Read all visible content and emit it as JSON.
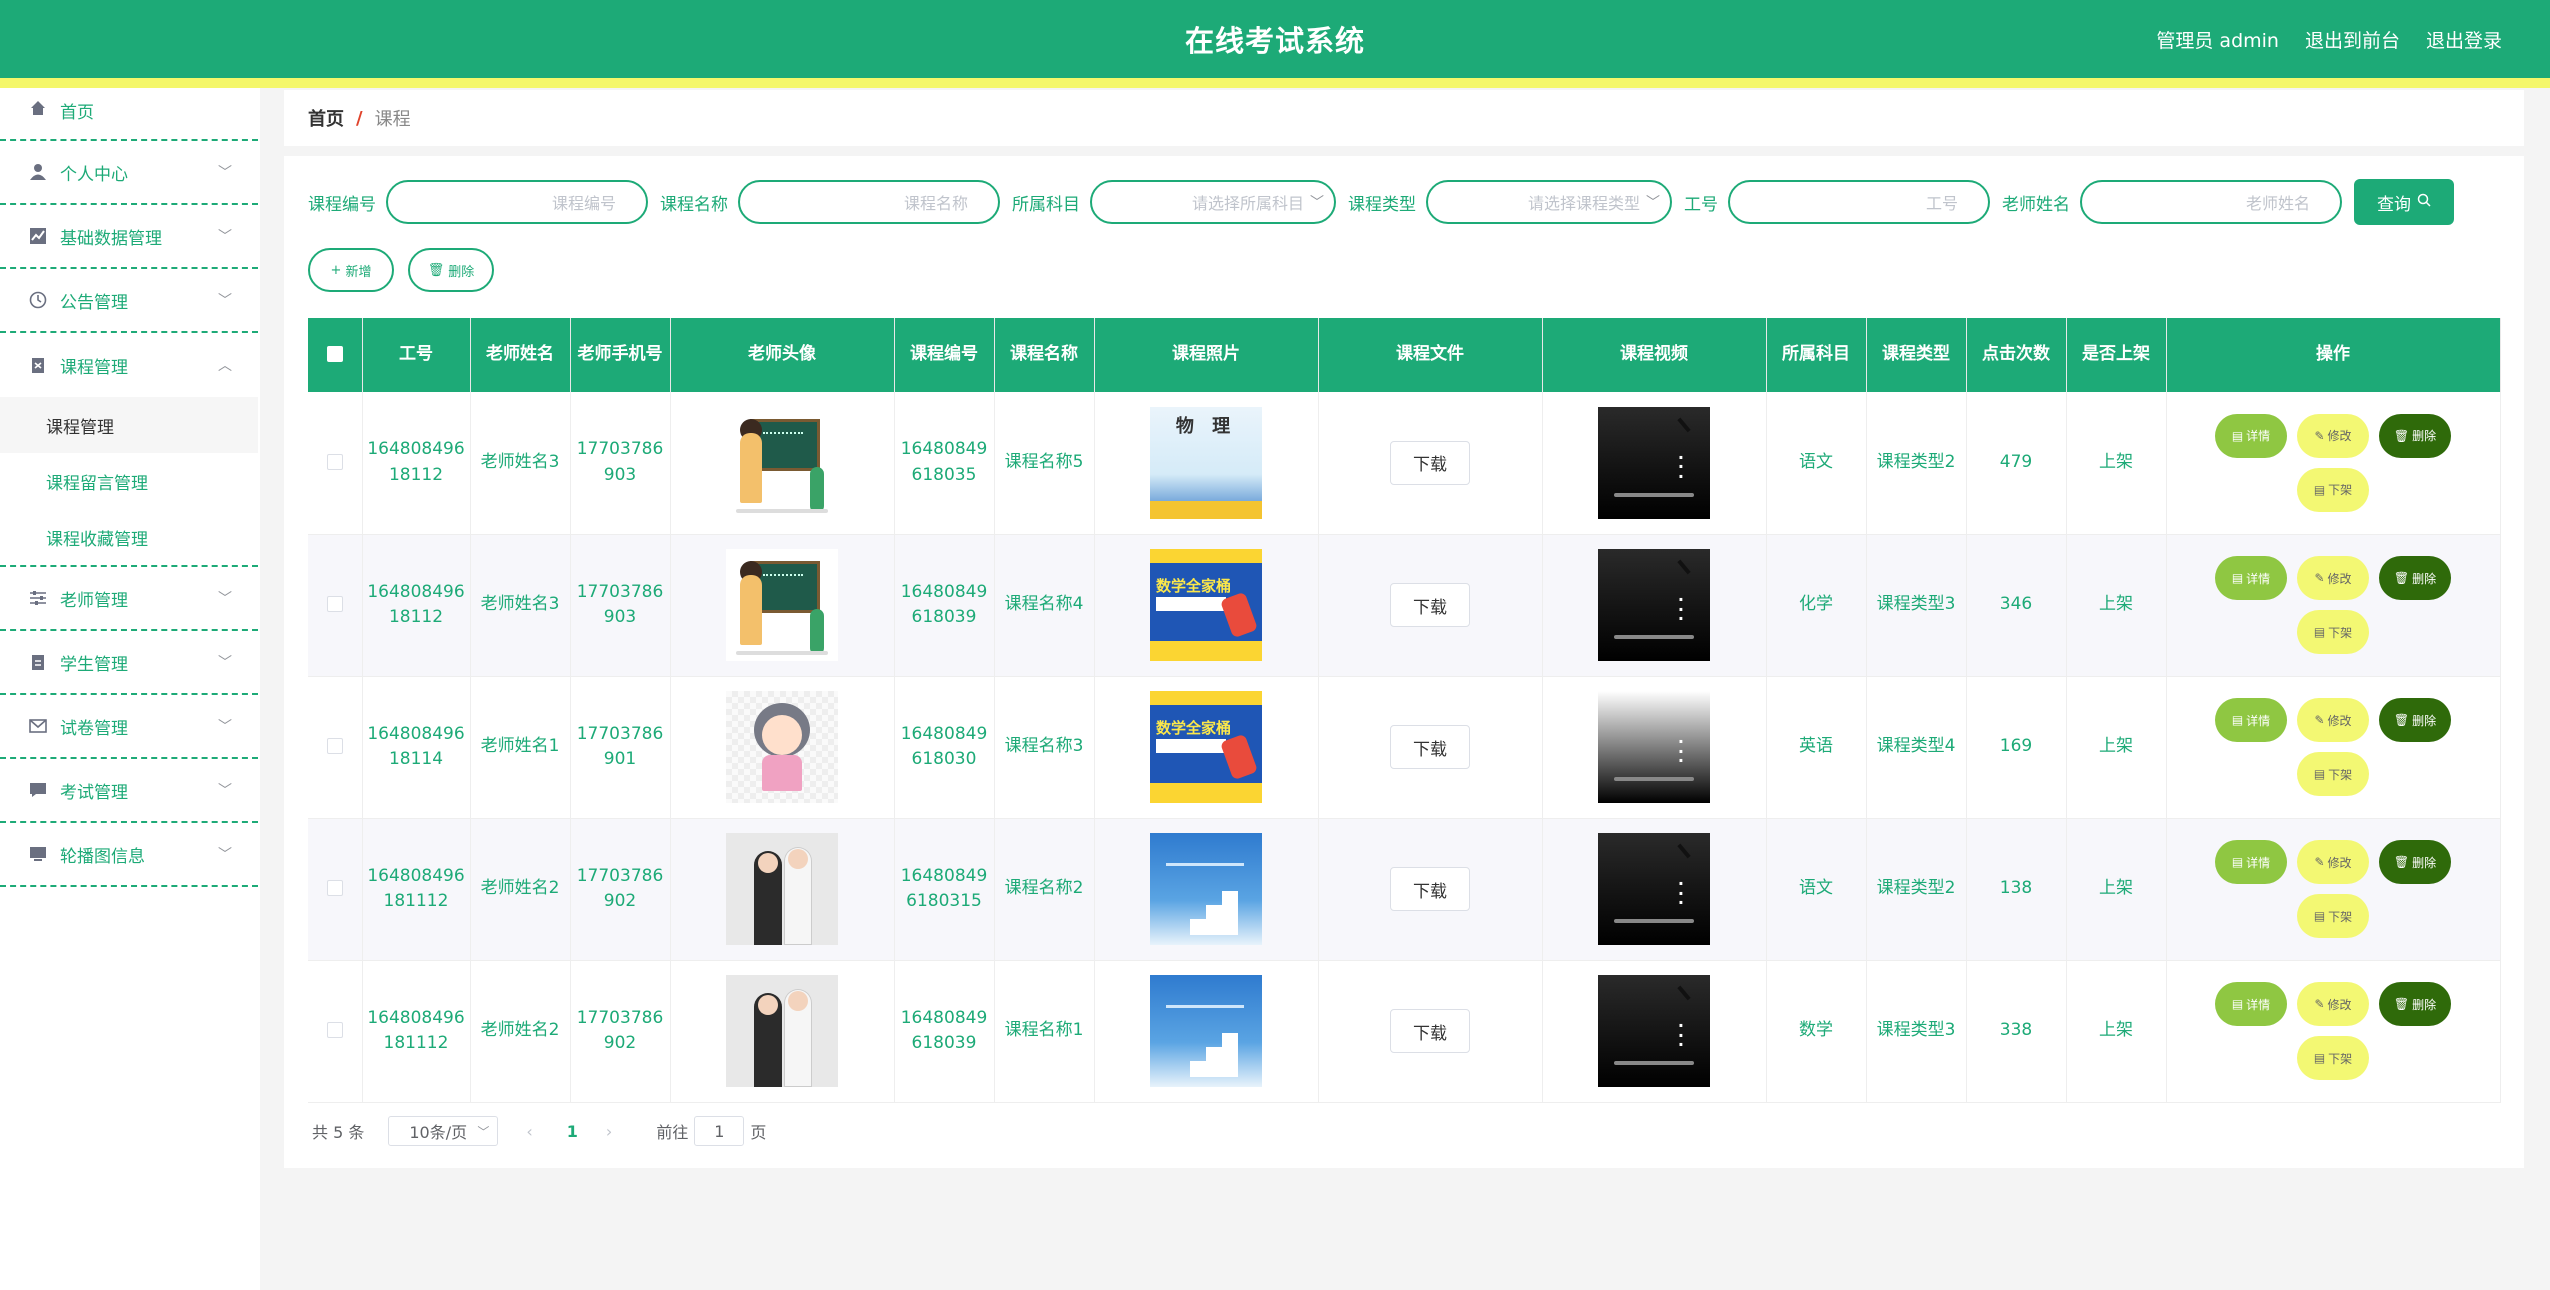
{
  "header": {
    "title": "在线考试系统",
    "user": "管理员 admin",
    "front_link": "退出到前台",
    "logout": "退出登录"
  },
  "sidebar": {
    "items": [
      {
        "label": "首页",
        "icon": "home-icon"
      },
      {
        "label": "个人中心",
        "icon": "user-icon"
      },
      {
        "label": "基础数据管理",
        "icon": "chart-icon"
      },
      {
        "label": "公告管理",
        "icon": "clock-icon"
      },
      {
        "label": "课程管理",
        "icon": "clipboard-icon",
        "children": [
          "课程管理",
          "课程留言管理",
          "课程收藏管理"
        ]
      },
      {
        "label": "老师管理",
        "icon": "sliders-icon"
      },
      {
        "label": "学生管理",
        "icon": "document-icon"
      },
      {
        "label": "试卷管理",
        "icon": "mail-icon"
      },
      {
        "label": "考试管理",
        "icon": "chat-icon"
      },
      {
        "label": "轮播图信息",
        "icon": "monitor-icon"
      }
    ]
  },
  "breadcrumb": {
    "home": "首页",
    "sep": "/",
    "current": "课程"
  },
  "search": {
    "fields": [
      {
        "label": "课程编号",
        "placeholder": "课程编号"
      },
      {
        "label": "课程名称",
        "placeholder": "课程名称"
      },
      {
        "label": "所属科目",
        "placeholder": "请选择所属科目"
      },
      {
        "label": "课程类型",
        "placeholder": "请选择课程类型"
      },
      {
        "label": "工号",
        "placeholder": "工号"
      },
      {
        "label": "老师姓名",
        "placeholder": "老师姓名"
      }
    ],
    "button": "查询"
  },
  "actions": {
    "add": "新增",
    "delete": "删除"
  },
  "table": {
    "headers": [
      "工号",
      "老师姓名",
      "老师手机号",
      "老师头像",
      "课程编号",
      "课程名称",
      "课程照片",
      "课程文件",
      "课程视频",
      "所属科目",
      "课程类型",
      "点击次数",
      "是否上架",
      "操作"
    ],
    "download_label": "下载",
    "ops": {
      "detail": "详情",
      "edit": "修改",
      "delete": "删除",
      "off": "下架"
    },
    "rows": [
      {
        "job_no": "16480849618112",
        "teacher": "老师姓名3",
        "phone": "17703786903",
        "avatar": "teacher",
        "course_no": "16480849618035",
        "course_name": "课程名称5",
        "photo": "physics",
        "photo_text": "物 理",
        "video": "dark",
        "subject": "语文",
        "type": "课程类型2",
        "clicks": "479",
        "on_shelf": "上架"
      },
      {
        "job_no": "16480849618112",
        "teacher": "老师姓名3",
        "phone": "17703786903",
        "avatar": "teacher",
        "course_no": "16480849618039",
        "course_name": "课程名称4",
        "photo": "math",
        "photo_text": "数学全家桶",
        "video": "dark",
        "subject": "化学",
        "type": "课程类型3",
        "clicks": "346",
        "on_shelf": "上架"
      },
      {
        "job_no": "16480849618114",
        "teacher": "老师姓名1",
        "phone": "17703786901",
        "avatar": "girl",
        "course_no": "16480849618030",
        "course_name": "课程名称3",
        "photo": "math",
        "photo_text": "数学全家桶",
        "video": "light",
        "subject": "英语",
        "type": "课程类型4",
        "clicks": "169",
        "on_shelf": "上架"
      },
      {
        "job_no": "164808496181112",
        "teacher": "老师姓名2",
        "phone": "17703786902",
        "avatar": "photo",
        "course_no": "164808496180315",
        "course_name": "课程名称2",
        "photo": "steps",
        "photo_text": "",
        "video": "dark",
        "subject": "语文",
        "type": "课程类型2",
        "clicks": "138",
        "on_shelf": "上架"
      },
      {
        "job_no": "164808496181112",
        "teacher": "老师姓名2",
        "phone": "17703786902",
        "avatar": "photo",
        "course_no": "16480849618039",
        "course_name": "课程名称1",
        "photo": "steps",
        "photo_text": "",
        "video": "dark",
        "subject": "数学",
        "type": "课程类型3",
        "clicks": "338",
        "on_shelf": "上架"
      }
    ]
  },
  "pagination": {
    "total": "共 5 条",
    "page_size": "10条/页",
    "prev": "‹",
    "current": "1",
    "next": "›",
    "goto_prefix": "前往",
    "goto_value": "1",
    "goto_suffix": "页"
  },
  "colors": {
    "primary": "#1daa77",
    "stripe": "#f4f76a",
    "detail": "#8fc742",
    "edit": "#f3f873",
    "delete": "#2f6a0a"
  }
}
